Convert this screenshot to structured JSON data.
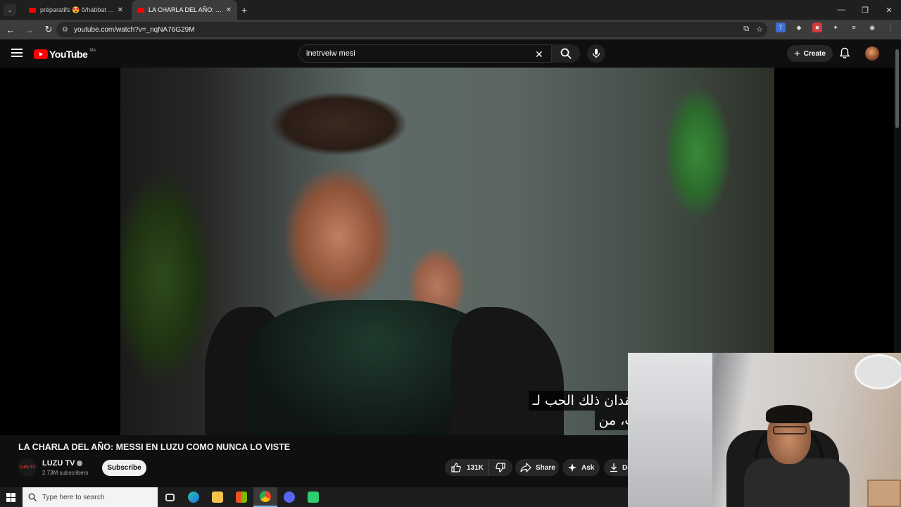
{
  "browser": {
    "tabs": [
      {
        "title": "préparatifs 😍 ô/habbat abdel",
        "active": false
      },
      {
        "title": "LA CHARLA DEL AÑO: MESSI EN",
        "active": true
      }
    ],
    "new_tab_glyph": "+",
    "close_glyph": "✕",
    "url": "youtube.com/watch?v=_nqNA76G29M"
  },
  "youtube": {
    "logo_text": "YouTube",
    "country_code": "MA",
    "search_query": "inetrveiw mesi",
    "create_label": "Create",
    "accent_color": "#ff0000"
  },
  "video": {
    "subtitle_lines": [
      "لم تتوقف أبداً عن فقدان ذلك الحب لـ",
      "أخ، أب، ابن، ابن، أب، من"
    ],
    "title": "LA CHARLA DEL AÑO: MESSI EN LUZU COMO NUNCA LO VISTE",
    "channel": {
      "name": "LUZU TV",
      "subscribers": "2.73M subscribers",
      "avatar_text": "LUZU TV"
    },
    "subscribe_label": "Subscribe",
    "likes": "131K",
    "share_label": "Share",
    "ask_label": "Ask",
    "download_label": "Do"
  },
  "taskbar": {
    "search_placeholder": "Type here to search"
  }
}
